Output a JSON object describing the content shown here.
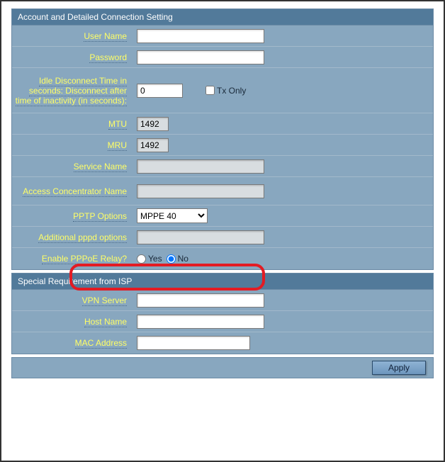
{
  "section1": {
    "title": "Account and Detailed Connection Setting",
    "user_name_label": "User Name",
    "user_name_value": "",
    "password_label": "Password",
    "password_value": "",
    "idle_label": "Idle Disconnect Time in seconds: Disconnect after time of inactivity (in seconds):",
    "idle_value": "0",
    "txonly_label": "Tx Only",
    "mtu_label": "MTU",
    "mtu_value": "1492",
    "mru_label": "MRU",
    "mru_value": "1492",
    "service_name_label": "Service Name",
    "service_name_value": "",
    "access_conc_label": "Access Concentrator Name",
    "access_conc_value": "",
    "pptp_options_label": "PPTP Options",
    "pptp_options_value": "MPPE 40",
    "additional_pppd_label": "Additional pppd options",
    "additional_pppd_value": "",
    "enable_pppoe_label": "Enable PPPoE Relay?",
    "radio_yes": "Yes",
    "radio_no": "No"
  },
  "section2": {
    "title": "Special Requirement from ISP",
    "vpn_server_label": "VPN Server",
    "vpn_server_value": "",
    "host_name_label": "Host Name",
    "host_name_value": "",
    "mac_label": "MAC Address",
    "mac_value": ""
  },
  "apply_label": "Apply"
}
